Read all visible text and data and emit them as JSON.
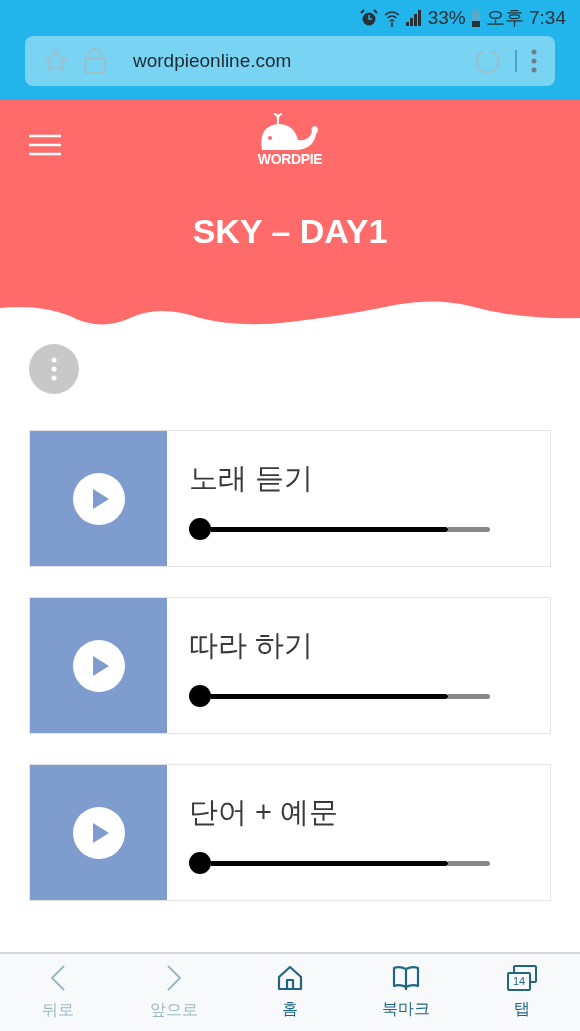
{
  "status_bar": {
    "battery": "33%",
    "time": "오후 7:34"
  },
  "browser": {
    "url": "wordpieonline.com"
  },
  "header": {
    "logo": "WORDPIE",
    "title": "SKY – DAY1"
  },
  "players": [
    {
      "label": "노래 듣기",
      "level": 0
    },
    {
      "label": "따라 하기",
      "level": 0
    },
    {
      "label": "단어 + 예문",
      "level": 0
    }
  ],
  "nav": [
    {
      "kind": "back",
      "label": "뒤로",
      "disabled": true
    },
    {
      "kind": "forward",
      "label": "앞으로",
      "disabled": true
    },
    {
      "kind": "home",
      "label": "홈",
      "disabled": false
    },
    {
      "kind": "bookmarks",
      "label": "북마크",
      "disabled": false
    },
    {
      "kind": "tabs",
      "label": "탭",
      "count": "14",
      "disabled": false
    }
  ]
}
